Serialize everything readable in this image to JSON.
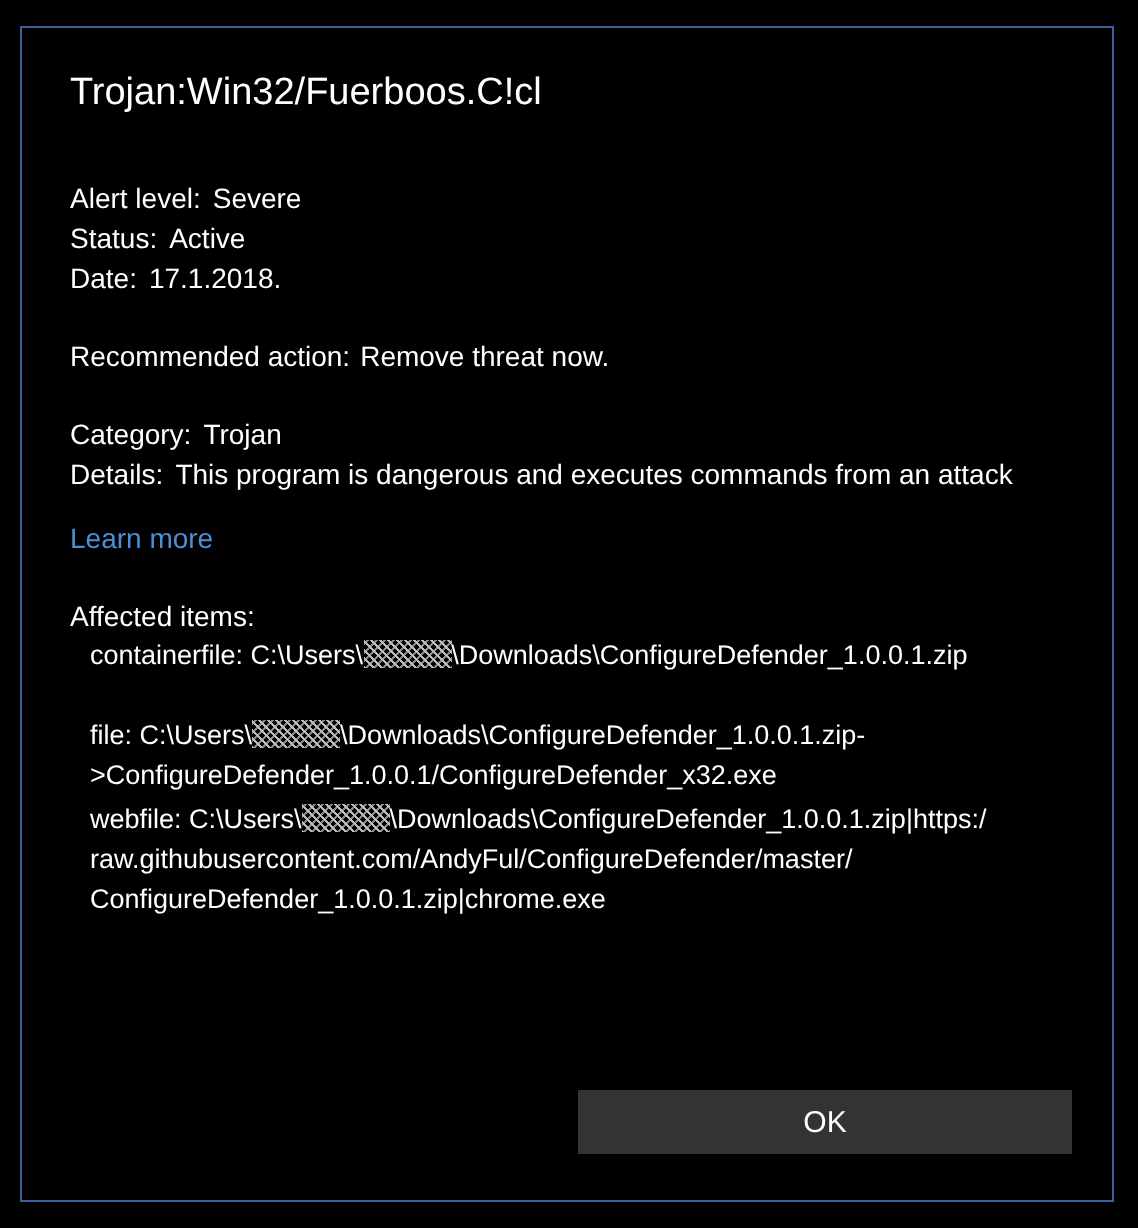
{
  "dialog": {
    "title": "Trojan:Win32/Fuerboos.C!cl",
    "status_fields": [
      {
        "label": "Alert level:",
        "value": "Severe"
      },
      {
        "label": "Status:",
        "value": "Active"
      },
      {
        "label": "Date:",
        "value": "17.1.2018."
      }
    ],
    "recommended_action": {
      "label": "Recommended action:",
      "value": "Remove threat now."
    },
    "info_fields": [
      {
        "label": "Category:",
        "value": "Trojan"
      },
      {
        "label": "Details:",
        "value": "This program is dangerous and executes commands from an attack"
      }
    ],
    "learn_more_link": "Learn more",
    "affected_items_heading": "Affected items:",
    "affected_items": [
      {
        "prefix": "containerfile: C:\\Users\\",
        "suffix": "\\Downloads\\ConfigureDefender_1.0.0.1.zip"
      },
      {
        "prefix": "file: C:\\Users\\",
        "suffix": "\\Downloads\\ConfigureDefender_1.0.0.1.zip-",
        "more_lines": [
          ">ConfigureDefender_1.0.0.1/ConfigureDefender_x32.exe"
        ]
      },
      {
        "prefix": "webfile: C:\\Users\\",
        "suffix": "\\Downloads\\ConfigureDefender_1.0.0.1.zip|https:/",
        "more_lines": [
          "raw.githubusercontent.com/AndyFul/ConfigureDefender/master/",
          "ConfigureDefender_1.0.0.1.zip|chrome.exe"
        ]
      }
    ],
    "ok_button": "OK"
  }
}
